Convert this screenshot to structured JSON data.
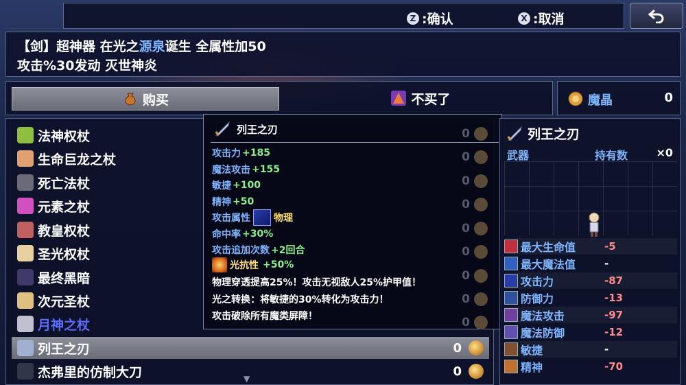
{
  "topbar": {
    "confirm": {
      "button": "Z",
      "label": ":确认"
    },
    "cancel": {
      "button": "X",
      "label": ":取消"
    }
  },
  "description": {
    "line1_a": "【剑】超神器 在光之",
    "line1_b": "源泉",
    "line1_c": "诞生 全属性加50",
    "line2": "攻击%30发动 灭世神炎"
  },
  "actions": {
    "buy": "购买",
    "no_buy": "不买了"
  },
  "currency": {
    "name": "魔晶",
    "amount": "0"
  },
  "items": [
    {
      "name": "法神权杖",
      "icon_color": "#8fbf40"
    },
    {
      "name": "生命巨龙之杖",
      "icon_color": "#e0a070"
    },
    {
      "name": "死亡法杖",
      "icon_color": "#6a6a7a"
    },
    {
      "name": "元素之杖",
      "icon_color": "#d050c0"
    },
    {
      "name": "教皇权杖",
      "icon_color": "#c06060"
    },
    {
      "name": "圣光权杖",
      "icon_color": "#e8d0a0"
    },
    {
      "name": "最终黑暗",
      "icon_color": "#403a6a"
    },
    {
      "name": "次元圣杖",
      "icon_color": "#e0c080"
    },
    {
      "name": "月神之杖",
      "icon_color": "#c0c0d0"
    },
    {
      "name": "列王之刃",
      "icon_color": "#a0b0d0",
      "count": "0"
    },
    {
      "name": "杰弗里的仿制大刀",
      "icon_color": "#303848",
      "count": "0"
    }
  ],
  "ghost_counts": [
    "0",
    "0",
    "0",
    "0",
    "0",
    "0",
    "0",
    "0",
    "0",
    "0",
    "0",
    "0"
  ],
  "tooltip": {
    "title": "列王之刃",
    "lines": [
      {
        "k": "攻击力",
        "v": "+185"
      },
      {
        "k": "魔法攻击",
        "v": "+155"
      },
      {
        "k": "敏捷",
        "v": "+100"
      },
      {
        "k": "精神",
        "v": "+50"
      },
      {
        "k": "命中率",
        "v": "+30%"
      },
      {
        "k": "攻击追加次数",
        "v": "+2回合"
      }
    ],
    "attr_label": "攻击属性",
    "attr_value": "物理",
    "light_res_label": "光抗性",
    "light_res_value": "+50%",
    "effect1": "物理穿透提高25%！攻击无视敌人25%护甲值！",
    "effect2": "光之转换：将敏捷的30%转化为攻击力！",
    "effect3": "攻击破除所有魔类屏障！"
  },
  "detail": {
    "title": "列王之刃",
    "type": "武器",
    "owned_label": "持有数",
    "owned": "×0",
    "stats": [
      {
        "name": "最大生命值",
        "value": "-5",
        "icon": "#c03040"
      },
      {
        "name": "最大魔法值",
        "value": "-",
        "icon": "#3060c0"
      },
      {
        "name": "攻击力",
        "value": "-87",
        "icon": "#2a3ca8"
      },
      {
        "name": "防御力",
        "value": "-13",
        "icon": "#3050a0"
      },
      {
        "name": "魔法攻击",
        "value": "-97",
        "icon": "#7040a0"
      },
      {
        "name": "魔法防御",
        "value": "-12",
        "icon": "#6050b0"
      },
      {
        "name": "敏捷",
        "value": "-",
        "icon": "#805030"
      },
      {
        "name": "精神",
        "value": "-70",
        "icon": "#c07030"
      }
    ]
  }
}
